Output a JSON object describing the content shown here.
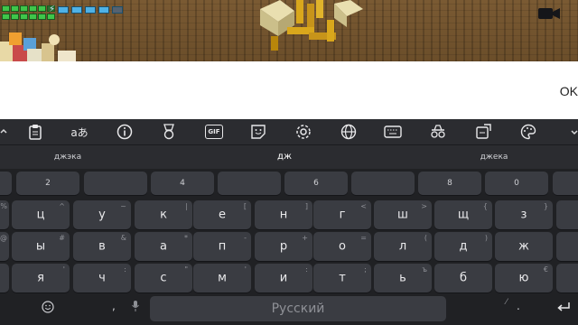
{
  "dialog": {
    "ok_label": "OK"
  },
  "toolbar": {
    "items": [
      "clipboard-icon",
      "translate-icon",
      "info-icon",
      "medal-icon",
      "gif-icon",
      "sticker-icon",
      "settings-icon",
      "globe-icon",
      "keyboard-icon",
      "incognito-icon",
      "resize-icon",
      "palette-icon"
    ],
    "translate_glyph": "aあ",
    "gif_label": "GIF"
  },
  "suggestions": [
    "джэка",
    "дж",
    "джека"
  ],
  "number_row": [
    "2",
    "4",
    "6",
    "8",
    "0"
  ],
  "letter_rows": [
    {
      "keys": [
        {
          "label": "ц",
          "hint": "^"
        },
        {
          "label": "у",
          "hint": "~"
        },
        {
          "label": "к",
          "hint": "|"
        },
        {
          "label": "е",
          "hint": "["
        },
        {
          "label": "н",
          "hint": "]"
        },
        {
          "label": "г",
          "hint": "<"
        },
        {
          "label": "ш",
          "hint": ">"
        },
        {
          "label": "щ",
          "hint": "{"
        },
        {
          "label": "з",
          "hint": "}"
        }
      ],
      "left_hint": "%",
      "left_hint2": ""
    },
    {
      "keys": [
        {
          "label": "ы",
          "hint": "#"
        },
        {
          "label": "в",
          "hint": "&"
        },
        {
          "label": "а",
          "hint": "*"
        },
        {
          "label": "п",
          "hint": "-"
        },
        {
          "label": "р",
          "hint": "+"
        },
        {
          "label": "о",
          "hint": "="
        },
        {
          "label": "л",
          "hint": "("
        },
        {
          "label": "д",
          "hint": ")"
        },
        {
          "label": "ж",
          "hint": ""
        }
      ],
      "left_hint": "@"
    },
    {
      "keys": [
        {
          "label": "я",
          "hint": "'"
        },
        {
          "label": "ч",
          "hint": ":"
        },
        {
          "label": "с",
          "hint": "\""
        },
        {
          "label": "м",
          "hint": "'"
        },
        {
          "label": "и",
          "hint": ":"
        },
        {
          "label": "т",
          "hint": ";"
        },
        {
          "label": "ь",
          "hint": "ъ"
        },
        {
          "label": "б",
          "hint": ""
        },
        {
          "label": "ю",
          "hint": "€"
        }
      ],
      "left_hint": ""
    }
  ],
  "bottom": {
    "space_label": "Русский",
    "emoji_icon": "emoji-icon",
    "comma": ",",
    "mic_icon": "mic-icon",
    "period": ".",
    "enter_icon": "enter-icon"
  },
  "colors": {
    "keyboard_bg": "#202124",
    "key_bg": "#3a3c42",
    "toolbar_bg": "#2b2c30",
    "health": "#3fc64a",
    "energy": "#4fb2e6"
  }
}
